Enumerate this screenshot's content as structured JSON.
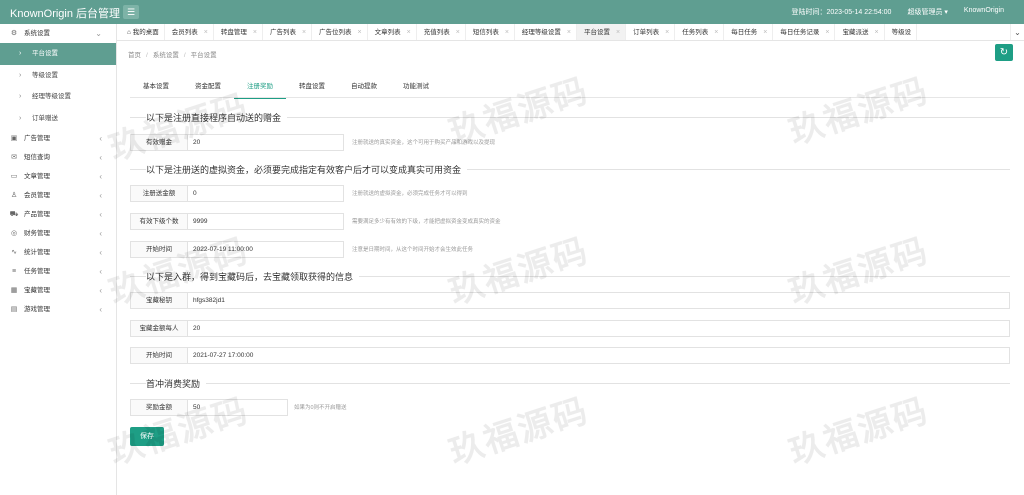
{
  "app": {
    "title": "KnownOrigin 后台管理"
  },
  "header": {
    "login_time": "登陆时间：2023-05-14 22:54:00",
    "user": "超级管理员",
    "site": "KnownOrigin"
  },
  "sidebar": {
    "groups": [
      {
        "label": "系统设置",
        "icon": "gear-icon",
        "expanded": true
      },
      {
        "label": "广告管理",
        "icon": "image-icon"
      },
      {
        "label": "短信查询",
        "icon": "mail-icon"
      },
      {
        "label": "文章管理",
        "icon": "folder-icon"
      },
      {
        "label": "会员管理",
        "icon": "user-icon"
      },
      {
        "label": "产品管理",
        "icon": "cart-icon"
      },
      {
        "label": "财务管理",
        "icon": "money-icon"
      },
      {
        "label": "统计管理",
        "icon": "chart-icon"
      },
      {
        "label": "任务管理",
        "icon": "sliders-icon"
      },
      {
        "label": "宝藏管理",
        "icon": "gift-icon"
      },
      {
        "label": "游戏管理",
        "icon": "game-icon"
      }
    ],
    "sub_items": [
      "平台设置",
      "等级设置",
      "经理等级设置",
      "订单赠送"
    ]
  },
  "tabs": [
    "我的桌面",
    "会员列表",
    "转盘管理",
    "广告列表",
    "广告位列表",
    "文章列表",
    "充值列表",
    "短信列表",
    "经理等级设置",
    "平台设置",
    "订单列表",
    "任务列表",
    "每日任务",
    "每日任务记录",
    "宝藏派送",
    "等级设"
  ],
  "breadcrumb": [
    "首页",
    "系统设置",
    "平台设置"
  ],
  "subtabs": [
    "基本设置",
    "资金配置",
    "注册奖励",
    "转盘设置",
    "自动提款",
    "功能测试"
  ],
  "sections": {
    "direct_bonus": "以下是注册直接程序自动送的赠金",
    "virtual_funds": "以下是注册送的虚拟资金，必须要完成指定有效客户后才可以变成真实可用资金",
    "treasure": "以下是入群，得到宝藏码后，去宝藏领取获得的信息",
    "first_charge": "首冲消费奖励"
  },
  "fields": {
    "valid_bonus": {
      "label": "有效赠金",
      "value": "20",
      "hint": "注册就送的真实资金，这个可用于购买产品和游戏以及提现"
    },
    "reg_amount": {
      "label": "注册送金额",
      "value": "0",
      "hint": "注册就送的虚拟资金，必须完成任务才可以得到"
    },
    "valid_count": {
      "label": "有效下级个数",
      "value": "9999",
      "hint": "需要满足多少有有效的下级，才能把虚拟资金变成真实的资金"
    },
    "start_time": {
      "label": "开始时间",
      "value": "2022-07-19 11:00:00",
      "hint": "注意是日期时间，从这个时间开始才会生效此任务"
    },
    "treasure_code": {
      "label": "宝藏秘钥",
      "value": "hfgs382jd1"
    },
    "treasure_amount": {
      "label": "宝藏金额每人",
      "value": "20"
    },
    "treasure_start": {
      "label": "开始时间",
      "value": "2021-07-27 17:00:00"
    },
    "reward_amount": {
      "label": "奖励金额",
      "value": "50",
      "hint": "如果为0则不开启赠送"
    }
  },
  "save_label": "保存",
  "watermark": "玖福源码",
  "colors": {
    "topbar": "#5f9e91",
    "accent": "#1e9e85"
  }
}
